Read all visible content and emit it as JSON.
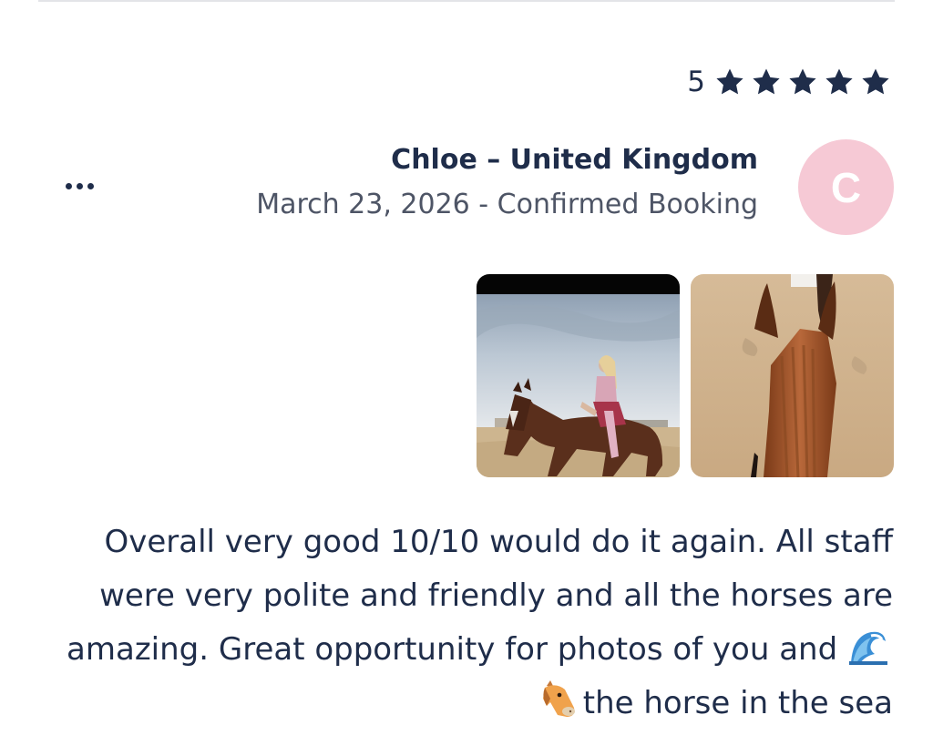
{
  "review": {
    "rating_value": "5",
    "star_count": 5,
    "star_color": "#1f2d4a",
    "reviewer_name": "Chloe – United Kingdom",
    "meta": "March 23, 2026 - Confirmed Booking",
    "avatar_initial": "C",
    "avatar_color": "#f6c9d5",
    "more_icon": "more-dots-icon",
    "photos": [
      {
        "name": "rider-on-horse-photo"
      },
      {
        "name": "horse-ears-pov-photo"
      }
    ],
    "text_main": "Overall very good 10/10 would do it again. All staff were very polite and friendly and all the horses are amazing. Great opportunity for photos of you and",
    "text_emojis": [
      "wave-emoji",
      "horse-face-emoji"
    ],
    "text_tail": "the horse in the sea"
  }
}
